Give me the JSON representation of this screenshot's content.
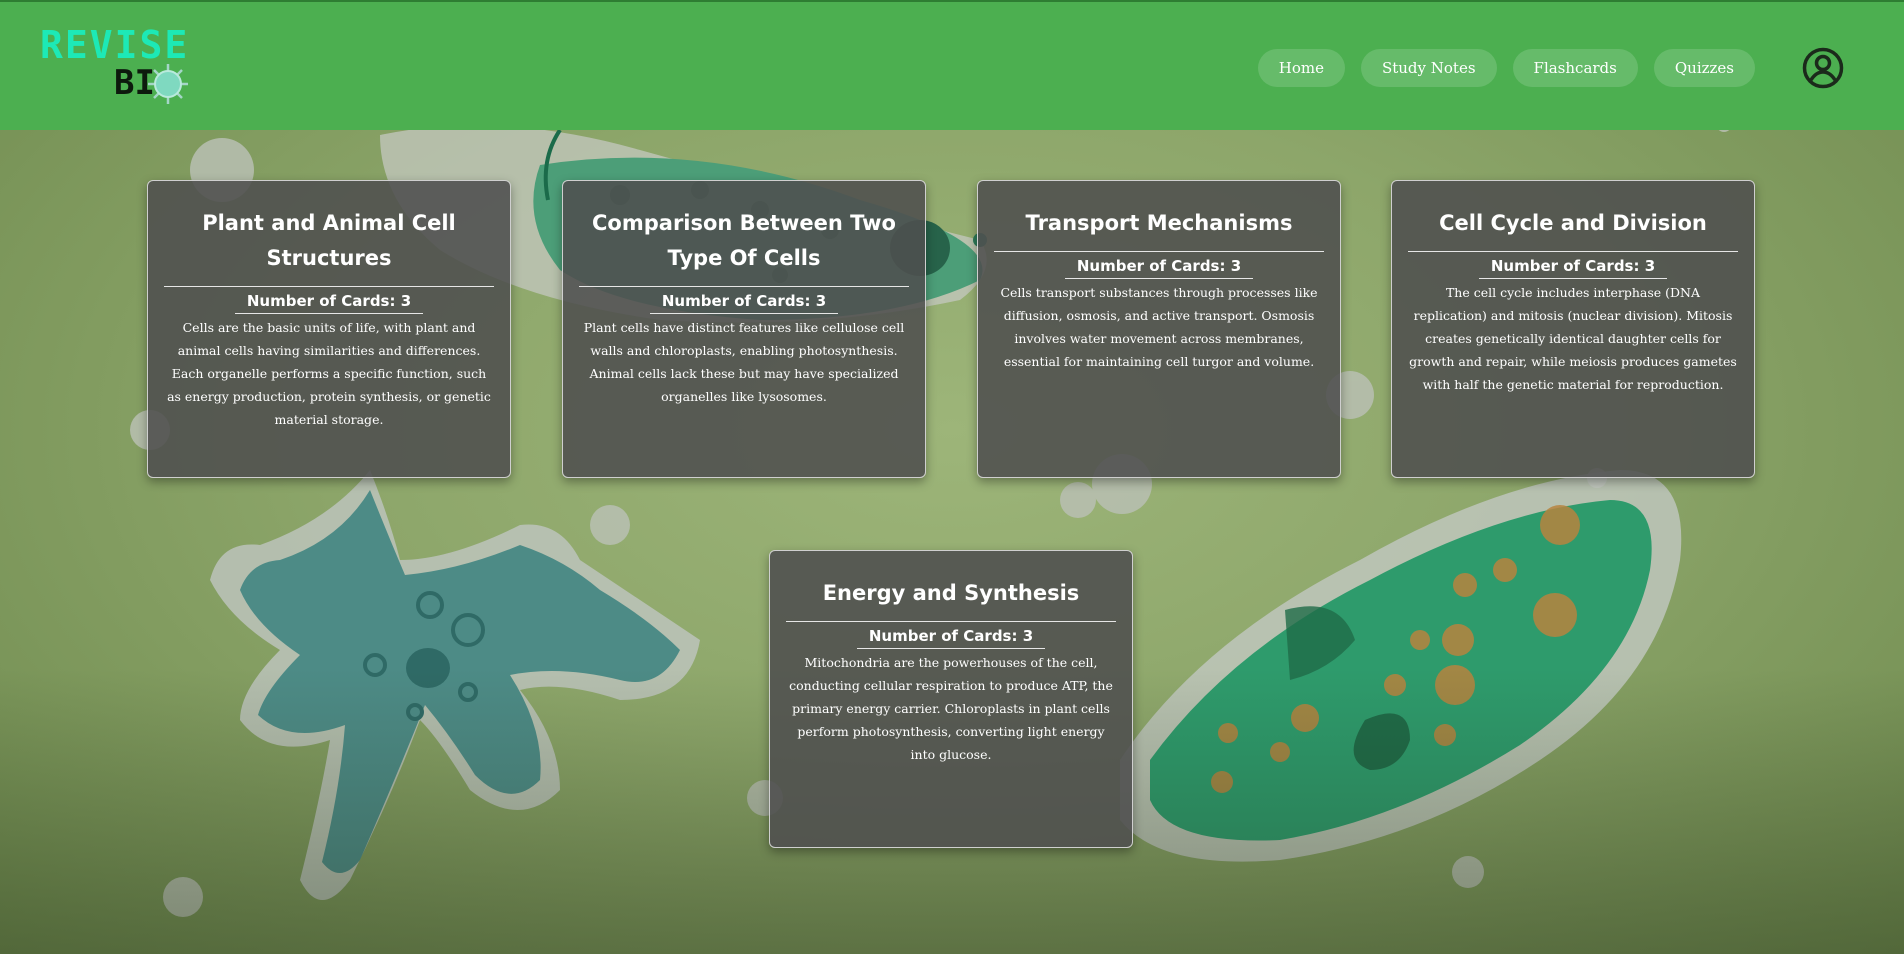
{
  "brand": {
    "logo_top": "REVISE",
    "logo_bottom": "BI",
    "colors": {
      "header": "#4caf50",
      "nav_pill": "#66bb6a",
      "logo_accent": "#1de9b6",
      "card_bg": "#4e4e4e"
    }
  },
  "nav": {
    "items": [
      {
        "label": "Home"
      },
      {
        "label": "Study Notes"
      },
      {
        "label": "Flashcards"
      },
      {
        "label": "Quizzes"
      }
    ],
    "profile_icon": "user-circle-icon"
  },
  "cards": [
    {
      "title": "Plant and Animal Cell Structures",
      "count": "Number of Cards: 3",
      "description": "Cells are the basic units of life, with plant and animal cells having similarities and differences. Each organelle performs a specific function, such as energy production, protein synthesis, or genetic material storage."
    },
    {
      "title": "Comparison Between Two Type Of Cells",
      "count": "Number of Cards: 3",
      "description": "Plant cells have distinct features like cellulose cell walls and chloroplasts, enabling photosynthesis. Animal cells lack these but may have specialized organelles like lysosomes."
    },
    {
      "title": "Transport Mechanisms",
      "count": "Number of Cards: 3",
      "description": "Cells transport substances through processes like diffusion, osmosis, and active transport. Osmosis involves water movement across membranes, essential for maintaining cell turgor and volume."
    },
    {
      "title": "Cell Cycle and Division",
      "count": "Number of Cards: 3",
      "description": "The cell cycle includes interphase (DNA replication) and mitosis (nuclear division). Mitosis creates genetically identical daughter cells for growth and repair, while meiosis produces gametes with half the genetic material for reproduction."
    },
    {
      "title": "Energy and Synthesis",
      "count": "Number of Cards: 3",
      "description": "Mitochondria are the powerhouses of the cell, conducting cellular respiration to produce ATP, the primary energy carrier. Chloroplasts in plant cells perform photosynthesis, converting light energy into glucose."
    }
  ]
}
